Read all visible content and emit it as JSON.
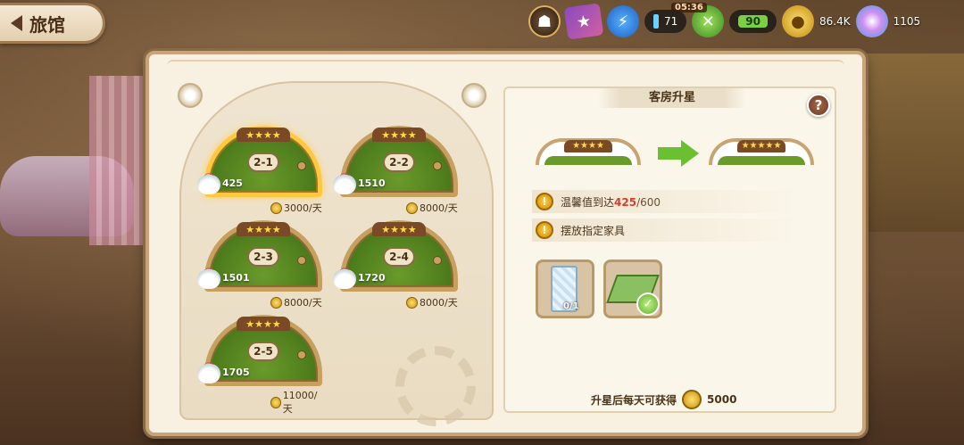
{
  "header": {
    "back_label": "旅馆"
  },
  "topbar": {
    "energy": "71",
    "timer": "05:36",
    "stamina": "90",
    "coins": "86.4K",
    "gems": "1105"
  },
  "rooms": [
    {
      "id": "2-1",
      "cozy": "425",
      "income": "3000/天",
      "selected": true
    },
    {
      "id": "2-2",
      "cozy": "1510",
      "income": "8000/天",
      "selected": false
    },
    {
      "id": "2-3",
      "cozy": "1501",
      "income": "8000/天",
      "selected": false
    },
    {
      "id": "2-4",
      "cozy": "1720",
      "income": "8000/天",
      "selected": false
    },
    {
      "id": "2-5",
      "cozy": "1705",
      "income": "11000/天",
      "selected": false
    }
  ],
  "upgrade": {
    "title": "客房升星",
    "help": "?",
    "req_cozy_label": "温馨值到达",
    "req_cozy_current": "425",
    "req_cozy_total": "/600",
    "req_furniture_label": "摆放指定家具",
    "furniture": [
      {
        "name": "wallpaper",
        "count": "0/1",
        "done": false
      },
      {
        "name": "floor-tile",
        "count": "",
        "done": true
      }
    ],
    "reward_label": "升星后每天可获得",
    "reward_value": "5000"
  },
  "colors": {
    "accent_green": "#6ac030",
    "star_gold": "#ffd84a",
    "warn_red": "#d04030"
  }
}
